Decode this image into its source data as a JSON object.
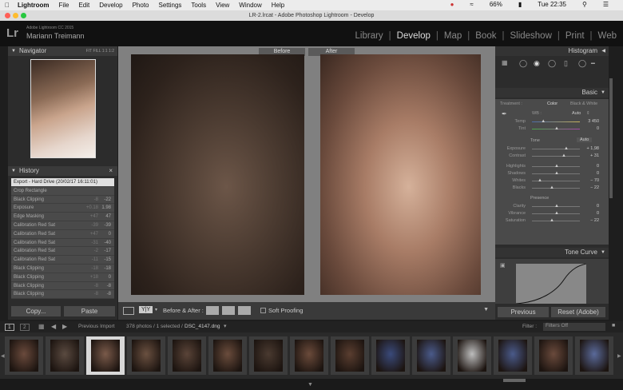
{
  "menubar": {
    "app": "Lightroom",
    "items": [
      "File",
      "Edit",
      "Develop",
      "Photo",
      "Settings",
      "Tools",
      "View",
      "Window",
      "Help"
    ],
    "battery": "66%",
    "time": "Tue 22:35"
  },
  "window_title": "LR-2.lrcat - Adobe Photoshop Lightroom - Develop",
  "identity": {
    "logo": "Lr",
    "catalog": "Adobe Lightroom CC 2015",
    "user": "Mariann Treimann"
  },
  "modules": [
    "Library",
    "Develop",
    "Map",
    "Book",
    "Slideshow",
    "Print",
    "Web"
  ],
  "active_module": "Develop",
  "navigator": {
    "title": "Navigator",
    "modes": [
      "FIT",
      "FILL",
      "1:1",
      "1:2"
    ]
  },
  "history": {
    "title": "History",
    "items": [
      {
        "label": "Export - Hard Drive (20/02/17 16:11:01)",
        "a": "",
        "b": ""
      },
      {
        "label": "Crop Rectangle",
        "a": "",
        "b": ""
      },
      {
        "label": "Black Clipping",
        "a": "-8",
        "b": "-22"
      },
      {
        "label": "Exposure",
        "a": "+0.18",
        "b": "1.98"
      },
      {
        "label": "Edge Masking",
        "a": "+47",
        "b": "47"
      },
      {
        "label": "Calibration Red Sat",
        "a": "-39",
        "b": "-39"
      },
      {
        "label": "Calibration Red Sat",
        "a": "+47",
        "b": "0"
      },
      {
        "label": "Calibration Red Sat",
        "a": "-31",
        "b": "-40"
      },
      {
        "label": "Calibration Red Sat",
        "a": "-2",
        "b": "-17"
      },
      {
        "label": "Calibration Red Sat",
        "a": "-11",
        "b": "-15"
      },
      {
        "label": "Black Clipping",
        "a": "-18",
        "b": "-18"
      },
      {
        "label": "Black Clipping",
        "a": "+18",
        "b": "0"
      },
      {
        "label": "Black Clipping",
        "a": "-8",
        "b": "-8"
      },
      {
        "label": "Black Clipping",
        "a": "-8",
        "b": "-8"
      }
    ]
  },
  "left_buttons": {
    "copy": "Copy...",
    "paste": "Paste"
  },
  "compare": {
    "before": "Before",
    "after": "After"
  },
  "toolbar": {
    "yy": "Y|Y",
    "ba": "Before & After :",
    "soft": "Soft Proofing"
  },
  "histogram": {
    "title": "Histogram"
  },
  "basic": {
    "title": "Basic",
    "treatment_label": "Treatment :",
    "color": "Color",
    "bw": "Black & White",
    "wb_label": "WB :",
    "wb_value": "Auto",
    "tone_label": "Tone",
    "auto": "Auto",
    "presence_label": "Presence",
    "sliders_wb": [
      {
        "label": "Temp",
        "value": "3 450",
        "pos": 0.22
      },
      {
        "label": "Tint",
        "value": "0",
        "pos": 0.5
      }
    ],
    "sliders_tone": [
      {
        "label": "Exposure",
        "value": "+ 1,98",
        "pos": 0.7
      },
      {
        "label": "Contrast",
        "value": "+ 31",
        "pos": 0.65
      },
      {
        "label": "Highlights",
        "value": "0",
        "pos": 0.5
      },
      {
        "label": "Shadows",
        "value": "0",
        "pos": 0.5
      },
      {
        "label": "Whites",
        "value": "− 70",
        "pos": 0.15
      },
      {
        "label": "Blacks",
        "value": "− 22",
        "pos": 0.4
      }
    ],
    "sliders_presence": [
      {
        "label": "Clarity",
        "value": "0",
        "pos": 0.5
      },
      {
        "label": "Vibrance",
        "value": "0",
        "pos": 0.5
      },
      {
        "label": "Saturation",
        "value": "− 22",
        "pos": 0.4
      }
    ]
  },
  "tone_curve": {
    "title": "Tone Curve"
  },
  "right_buttons": {
    "previous": "Previous",
    "reset": "Reset (Adobe)"
  },
  "filmstrip": {
    "pages": [
      "1",
      "2"
    ],
    "source": "Previous Import",
    "count": "378 photos / 1 selected /",
    "file": "DSC_4147.dng",
    "filter_label": "Filter :",
    "filter_value": "Filters Off"
  },
  "colors": {
    "accent": "#e0e0e0",
    "panel": "#2c2c2c"
  }
}
